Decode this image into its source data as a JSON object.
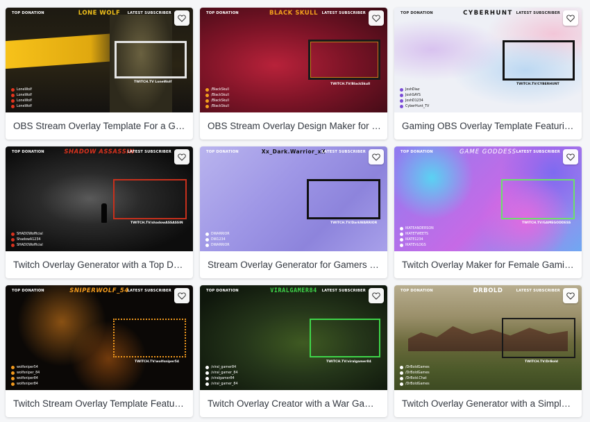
{
  "cards": [
    {
      "title": "OBS Stream Overlay Template For a Gaming Channel",
      "streamer": "LONE WOLF",
      "left_label": "TOP DONATION",
      "right_label": "LATEST SUBSCRIBER",
      "caption": "TWITCH.TV LoneWolf",
      "donors": [
        "LoneWolf",
        "LoneWolf",
        "LoneWolf",
        "LoneWolf"
      ]
    },
    {
      "title": "OBS Stream Overlay Design Maker for Gamers",
      "streamer": "BLACK SKULL",
      "left_label": "TOP DONATION",
      "right_label": "LATEST SUBSCRIBER",
      "caption": "TWITCH.TV/BlackSkull",
      "donors": [
        "/BlackSkull",
        "/BlackSkull",
        "/BlackSkull",
        "/BlackSkull"
      ]
    },
    {
      "title": "Gaming OBS Overlay Template Featuring a Marble Background",
      "streamer": "CYBERHUNT",
      "left_label": "TOP DONATION",
      "right_label": "LATEST SUBSCRIBER",
      "caption": "TWITCH.TV/CYBERHUNT",
      "donors": [
        "JoshDiaz",
        "JoshSAYS",
        "JoshD1234",
        "CyberHunt_TV"
      ]
    },
    {
      "title": "Twitch Overlay Generator with a Top Donation Box",
      "streamer": "SHADOW ASSASSIN",
      "left_label": "TOP DONATION",
      "right_label": "LATEST SUBSCRIBER",
      "caption": "TWITCH.TV/shadowASSASSIN",
      "donors": [
        "SHADOWofficial",
        "ShadowA1234",
        "SHADOWofficial"
      ]
    },
    {
      "title": "Stream Overlay Generator for Gamers Featuring Geometric Shapes",
      "streamer": "Xx_Dark.Warrior_xX",
      "left_label": "TOP DONATION",
      "right_label": "LATEST SUBSCRIBER",
      "caption": "TWITCH.TV/DarkWARRIOR",
      "donors": [
        "DWARRIOR",
        "DW1234",
        "DWARRIOR"
      ]
    },
    {
      "title": "Twitch Overlay Maker for Female Gaming Streamers",
      "streamer": "GAME GODDESS",
      "left_label": "TOP DONATION",
      "right_label": "LATEST SUBSCRIBER",
      "caption": "TWITCH.TV/GAMEGODDESS",
      "donors": [
        "IKATEANDERSON",
        "IKATETWEETS",
        "IKATE1234",
        "IKATEVLOGS"
      ]
    },
    {
      "title": "Twitch Stream Overlay Template Featuring a Keyboard Background",
      "streamer": "SNIPERWOLF_54",
      "left_label": "TOP DONATION",
      "right_label": "LATEST SUBSCRIBER",
      "caption": "TWITCH.TV/wolfsniper54",
      "donors": [
        "wolfsniper54",
        "wolfsniper_84",
        "wolfsniper84",
        "wolfsniper84"
      ]
    },
    {
      "title": "Twitch Overlay Creator with a War Game Scene",
      "streamer": "VIRALGAMER84",
      "left_label": "TOP DONATION",
      "right_label": "LATEST SUBSCRIBER",
      "caption": "TWITCH.TV/viralgamer84",
      "donors": [
        "/viral_gamer84",
        "/viral_gamer_84",
        "/viralgamer84",
        "/viral_gamer_84"
      ]
    },
    {
      "title": "Twitch Overlay Generator with a Simple Theme",
      "streamer": "DRBOLD",
      "left_label": "TOP DONATION",
      "right_label": "LATEST SUBSCRIBER",
      "caption": "TWITCH.TV/DrBold",
      "donors": [
        "/DrBoldGames",
        "/DrBoldGames",
        "/DrBold.Chat",
        "/DrBoldGames"
      ]
    }
  ]
}
